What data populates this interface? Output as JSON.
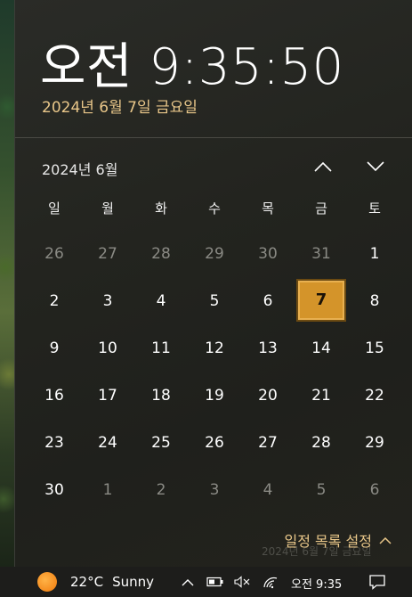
{
  "clock": {
    "time": "오전 9:35:50",
    "date": "2024년 6월 7일 금요일"
  },
  "calendar": {
    "month_label": "2024년 6월",
    "nav_up_icon": "chevron-up-icon",
    "nav_down_icon": "chevron-down-icon",
    "weekdays": [
      "일",
      "월",
      "화",
      "수",
      "목",
      "금",
      "토"
    ],
    "days": [
      {
        "n": "26",
        "other": true
      },
      {
        "n": "27",
        "other": true
      },
      {
        "n": "28",
        "other": true
      },
      {
        "n": "29",
        "other": true
      },
      {
        "n": "30",
        "other": true
      },
      {
        "n": "31",
        "other": true
      },
      {
        "n": "1"
      },
      {
        "n": "2"
      },
      {
        "n": "3"
      },
      {
        "n": "4"
      },
      {
        "n": "5"
      },
      {
        "n": "6"
      },
      {
        "n": "7",
        "today": true
      },
      {
        "n": "8"
      },
      {
        "n": "9"
      },
      {
        "n": "10"
      },
      {
        "n": "11"
      },
      {
        "n": "12"
      },
      {
        "n": "13"
      },
      {
        "n": "14"
      },
      {
        "n": "15"
      },
      {
        "n": "16"
      },
      {
        "n": "17"
      },
      {
        "n": "18"
      },
      {
        "n": "19"
      },
      {
        "n": "20"
      },
      {
        "n": "21"
      },
      {
        "n": "22"
      },
      {
        "n": "23"
      },
      {
        "n": "24"
      },
      {
        "n": "25"
      },
      {
        "n": "26"
      },
      {
        "n": "27"
      },
      {
        "n": "28"
      },
      {
        "n": "29"
      },
      {
        "n": "30"
      },
      {
        "n": "1",
        "other": true
      },
      {
        "n": "2",
        "other": true
      },
      {
        "n": "3",
        "other": true
      },
      {
        "n": "4",
        "other": true
      },
      {
        "n": "5",
        "other": true
      },
      {
        "n": "6",
        "other": true
      }
    ]
  },
  "schedule": {
    "label": "일정 목록 설정",
    "icon": "chevron-up-icon"
  },
  "ghost_text": "2024년 6월 7일 금요일",
  "taskbar": {
    "weather_icon": "sun-icon",
    "temperature": "22°C",
    "condition": "Sunny",
    "tray_icons": [
      "chevron-up-icon",
      "battery-icon",
      "volume-muted-icon",
      "wifi-icon"
    ],
    "time": "오전 9:35",
    "notification_icon": "notification-icon"
  },
  "colors": {
    "accent": "#d4942a",
    "date_text": "#e8c689"
  }
}
